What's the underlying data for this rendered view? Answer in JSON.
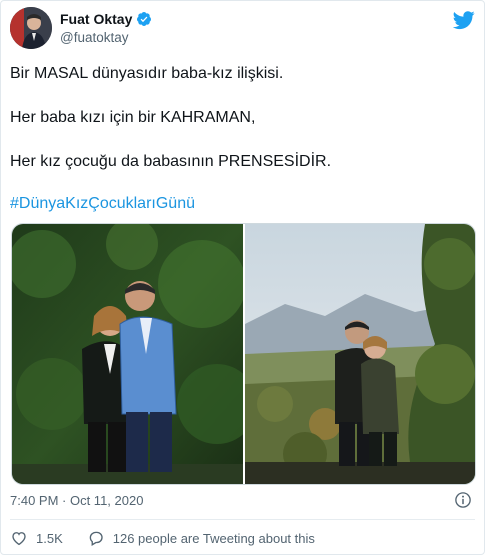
{
  "author": {
    "name": "Fuat Oktay",
    "handle": "@fuatoktay"
  },
  "tweet": {
    "lines": [
      "Bir MASAL dünyasıdır baba-kız ilişkisi.",
      "Her baba kızı için bir KAHRAMAN,",
      "Her kız çocuğu da babasının PRENSESİDİR.",
      "#DünyaKızÇocuklarıGünü"
    ]
  },
  "meta": {
    "timestamp": "7:40 PM · Oct 11, 2020"
  },
  "actions": {
    "likes": "1.5K",
    "tweeting": "126 people are Tweeting about this"
  },
  "icons": {
    "verified": "verified-badge-icon",
    "bird": "twitter-bird-icon",
    "info": "info-icon",
    "heart": "heart-icon",
    "reply": "speech-bubble-icon"
  },
  "colors": {
    "twitter_blue": "#1da1f2",
    "hashtag": "#1b95e0",
    "secondary_text": "#536471"
  }
}
